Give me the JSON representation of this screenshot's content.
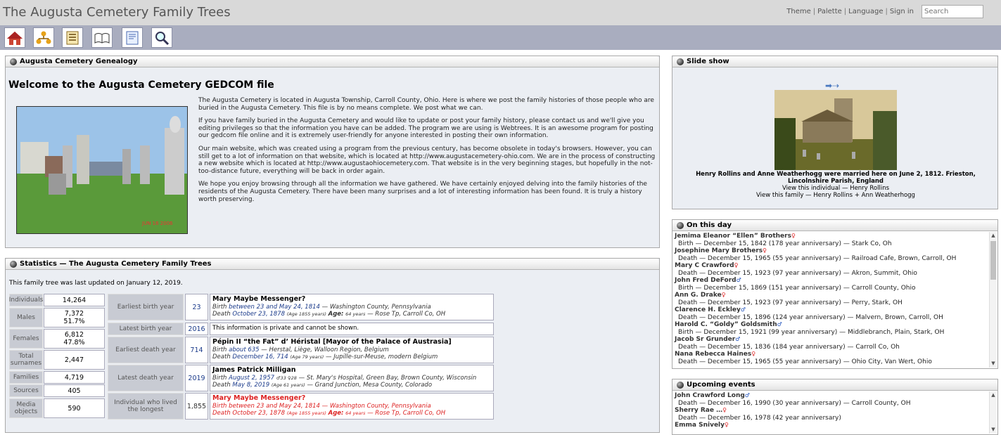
{
  "header": {
    "site_title": "The Augusta Cemetery Family Trees",
    "links": [
      "Theme",
      "Palette",
      "Language",
      "Sign in"
    ],
    "search_placeholder": "Search"
  },
  "toolbar": {
    "icons": [
      "home-icon",
      "family-tree-icon",
      "list-icon",
      "book-icon",
      "report-icon",
      "search-icon"
    ]
  },
  "welcome": {
    "panel_title": "Augusta Cemetery Genealogy",
    "heading": "Welcome to the Augusta Cemetery GEDCOM file",
    "photo_stamp": "JUN 16 2006",
    "paragraphs": [
      "The Augusta Cemetery is located in Augusta Township, Carroll County, Ohio.  Here is where we post the family histories of those people who are buried in the Augusta Cemetery.  This file is by no means complete.  We post what we can.",
      "If you have family buried in the Augusta Cemetery and would like to update or post your family history, please contact us and we'll give you editing privileges so that the information you have can be added.   The program we are using is Webtrees.  It is an awesome program for posting our gedcom file online and it is extremely user-friendly for anyone interested in posting their own information.",
      "Our main website, which was created using a program from the previous century, has become obsolete in today's browsers.  However, you can still get to a lot of information on that website, which is located at http://www.augustacemetery-ohio.com.  We are in the process of constructing a new website which is located at http://www.augustaohiocemetery.com.  That website is in the very beginning stages, but hopefully in the not-too-distance future, everything will be back in order again.",
      "We hope you enjoy browsing through all the information we have gathered.  We have certainly enjoyed delving into the family histories of the residents of the Augusta Cemetery.  There have been many surprises and a lot of interesting information has been found.  It is truly a history worth preserving."
    ]
  },
  "stats": {
    "panel_title": "Statistics — The Augusta Cemetery Family Trees",
    "updated": "This family tree was last updated on January 12, 2019.",
    "counts": [
      {
        "label": "Individuals",
        "value": "14,264",
        "pct": ""
      },
      {
        "label": "Males",
        "value": "7,372",
        "pct": "51.7%"
      },
      {
        "label": "Females",
        "value": "6,812",
        "pct": "47.8%"
      },
      {
        "label": "Total surnames",
        "value": "2,447",
        "pct": ""
      },
      {
        "label": "Families",
        "value": "4,719",
        "pct": ""
      },
      {
        "label": "Sources",
        "value": "405",
        "pct": ""
      },
      {
        "label": "Media objects",
        "value": "590",
        "pct": ""
      }
    ],
    "rows": [
      {
        "label": "Earliest birth year",
        "year": "23",
        "name": "Mary Maybe Messenger?",
        "l1_ev": "Birth",
        "l1_date": "between 23 and May 24, 1814",
        "l1_rest": " — Washington County, Pennsylvania",
        "l2_ev": "Death",
        "l2_date": "October 23, 1878",
        "l2_age": "(Age 1855 years)",
        "l2_ageword": "Age:",
        "l2_age2": "64 years",
        "l2_rest": " — Rose Tp, Carroll Co, OH"
      },
      {
        "label": "Latest birth year",
        "year": "2016",
        "private": "This information is private and cannot be shown."
      },
      {
        "label": "Earliest death year",
        "year": "714",
        "name": "Pépin II “the Fat” d’ Héristal [Mayor of the Palace of Austrasia]",
        "l1_ev": "Birth",
        "l1_date": "about 635",
        "l1_rest": " — Herstal, Liège, Walloon Region, Belgium",
        "l2_ev": "Death",
        "l2_date": "December 16, 714",
        "l2_age": "(Age 79 years)",
        "l2_rest": " — Jupille-sur-Meuse, modern Belgium"
      },
      {
        "label": "Latest death year",
        "year": "2019",
        "name": "James Patrick Milligan",
        "l1_ev": "Birth",
        "l1_date": "August 2, 1957",
        "l1_extra": "♂33 ♀28",
        "l1_rest": " — St. Mary's Hospital, Green Bay, Brown County, Wisconsin",
        "l2_ev": "Death",
        "l2_date": "May 8, 2019",
        "l2_age": "(Age 61 years)",
        "l2_rest": " — Grand Junction, Mesa County, Colorado"
      },
      {
        "label": "Individual who lived the longest",
        "year": "1,855",
        "name": "Mary Maybe Messenger?",
        "l1_ev": "Birth",
        "l1_date": "between 23 and May 24, 1814",
        "l1_rest": " — Washington County, Pennsylvania",
        "l2_ev": "Death",
        "l2_date": "October 23, 1878",
        "l2_age": "(Age 1855 years)",
        "l2_ageword": "Age:",
        "l2_age2": "64 years",
        "l2_rest": " — Rose Tp, Carroll Co, OH"
      }
    ]
  },
  "slideshow": {
    "panel_title": "Slide show",
    "caption": "Henry Rollins and Anne Weatherhogg were married here on June 2, 1812. Frieston, Lincolnshire Parish, England",
    "link1": "View this individual — Henry Rollins",
    "link2": "View this family — Henry Rollins + Ann Weatherhogg"
  },
  "on_this_day": {
    "panel_title": "On this day",
    "items": [
      {
        "name": "Jemima Eleanor “Ellen” Brothers",
        "sex": "F",
        "event": "Birth — December 15, 1842 (178 year anniversary) — Stark Co, Oh"
      },
      {
        "name": "Josephine Mary Brothers",
        "sex": "F",
        "event": "Death — December 15, 1965 (55 year anniversary) — Railroad Cafe, Brown, Carroll, OH"
      },
      {
        "name": "Mary C Crawford",
        "sex": "F",
        "event": "Death — December 15, 1923 (97 year anniversary) — Akron, Summit, Ohio"
      },
      {
        "name": "John Fred DeFord",
        "sex": "M",
        "event": "Birth — December 15, 1869 (151 year anniversary) — Carroll County, Ohio"
      },
      {
        "name": "Ann G. Drake",
        "sex": "F",
        "event": "Death — December 15, 1923 (97 year anniversary) — Perry, Stark, OH"
      },
      {
        "name": "Clarence H. Eckley",
        "sex": "M",
        "event": "Death — December 15, 1896 (124 year anniversary) — Malvern, Brown, Carroll, OH"
      },
      {
        "name": "Harold C. “Goldy” Goldsmith",
        "sex": "M",
        "event": "Birth — December 15, 1921 (99 year anniversary) — Middlebranch, Plain, Stark, OH"
      },
      {
        "name": "Jacob Sr Grunder",
        "sex": "M",
        "event": "Death — December 15, 1836 (184 year anniversary) — Carroll Co, Oh"
      },
      {
        "name": "Nana Rebecca Haines",
        "sex": "F",
        "event": "Death — December 15, 1965 (55 year anniversary) — Ohio City, Van Wert, Ohio"
      }
    ]
  },
  "upcoming": {
    "panel_title": "Upcoming events",
    "items": [
      {
        "name": "John Crawford Long",
        "sex": "M",
        "event": "Death — December 16, 1990 (30 year anniversary) — Carroll County, OH"
      },
      {
        "name": "Sherry Rae …",
        "sex": "F",
        "event": "Death — December 16, 1978 (42 year anniversary)"
      },
      {
        "name": "Emma Snively",
        "sex": "F",
        "event": ""
      }
    ]
  }
}
